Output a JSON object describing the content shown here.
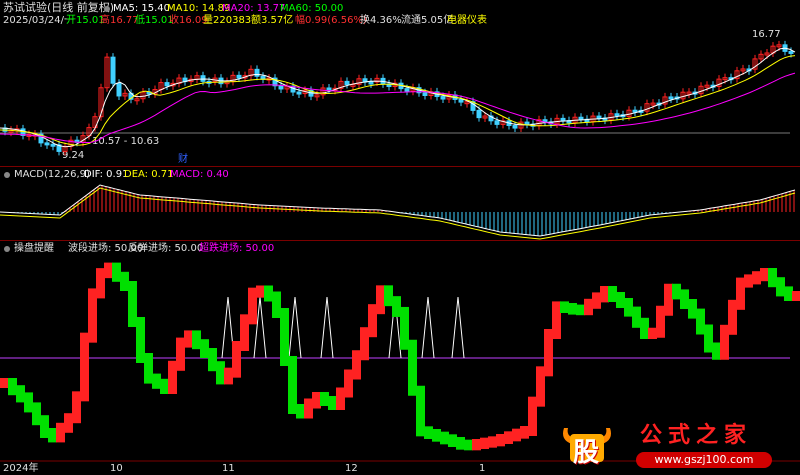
{
  "header": {
    "title": "苏试试验(日线 前复权)",
    "date_line": "2025/03/24/一",
    "open_label": "开15.01",
    "high_label": "高16.77",
    "low_label": "低15.01",
    "close_label": "收16.09",
    "volume_label": "量220383",
    "amount_label": "额3.57亿",
    "change_label": "幅0.99(6.56%)",
    "turnover_label": "换4.36%",
    "float_label": "流通5.05亿",
    "industry_label": "电器仪表"
  },
  "ma_legend": {
    "ma5": "MA5: 15.40",
    "ma10": "MA10: 14.89",
    "ma20": "MA20: 13.77",
    "ma60": "MA60: 50.00"
  },
  "price_annotations": {
    "high_mark": "16.77",
    "low_mark": "9.24",
    "range_mark": "10.57 - 10.63",
    "event_mark": "财"
  },
  "macd_legend": {
    "name": "MACD(12,26,9)",
    "dif": "DIF: 0.91",
    "dea": "DEA: 0.71",
    "macd": "MACD: 0.40"
  },
  "indicator_legend": {
    "name": "操盘提醒",
    "wave": "波段进场: 50.00",
    "rebound": "反弹进场: 50.00",
    "oversold": "超跌进场: 50.00"
  },
  "x_axis": {
    "year": "2024年",
    "m10": "10",
    "m11": "11",
    "m12": "12",
    "m1": "1"
  },
  "watermark": {
    "char": "股",
    "text": "公式之家",
    "url": "www.gszj100.com"
  },
  "colors": {
    "up": "#ff2222",
    "down": "#00e000",
    "ma5": "#ffffff",
    "ma10": "#ffff00",
    "ma20": "#ff00ff",
    "ma60": "#00ff00",
    "line": "#ffffff",
    "baseline": "#c040ff"
  }
}
